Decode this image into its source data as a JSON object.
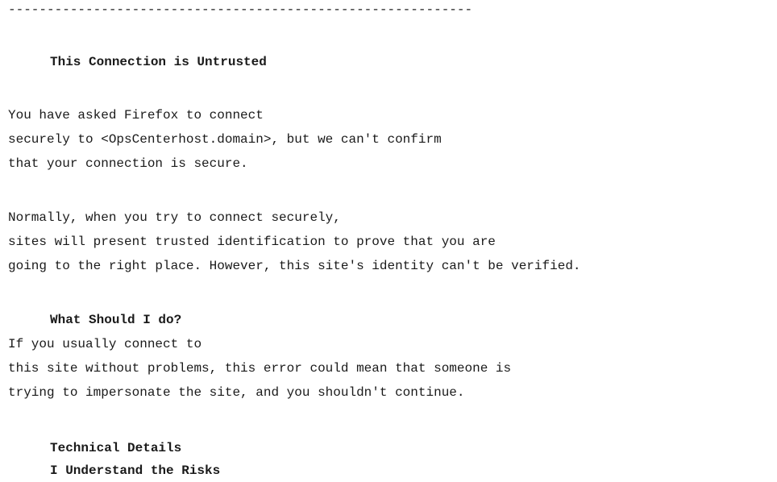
{
  "divider": "------------------------------------------------------------",
  "title": "This Connection is Untrusted",
  "intro": {
    "lines": [
      "You have asked Firefox to connect",
      "securely to <OpsCenterhost.domain>, but we can't confirm",
      "that your connection is secure."
    ]
  },
  "normally": {
    "lines": [
      "Normally, when you try to connect securely,",
      "sites will present trusted identification to prove that you are",
      "going to the right place. However, this site's identity can't be verified."
    ]
  },
  "what_should": {
    "heading": "What Should I do?",
    "lines": [
      "If you usually connect to",
      "this site without problems, this error could mean that someone is",
      "trying to impersonate the site, and you shouldn't continue."
    ]
  },
  "technical_details": "Technical Details",
  "understand_risks": "I Understand the Risks"
}
